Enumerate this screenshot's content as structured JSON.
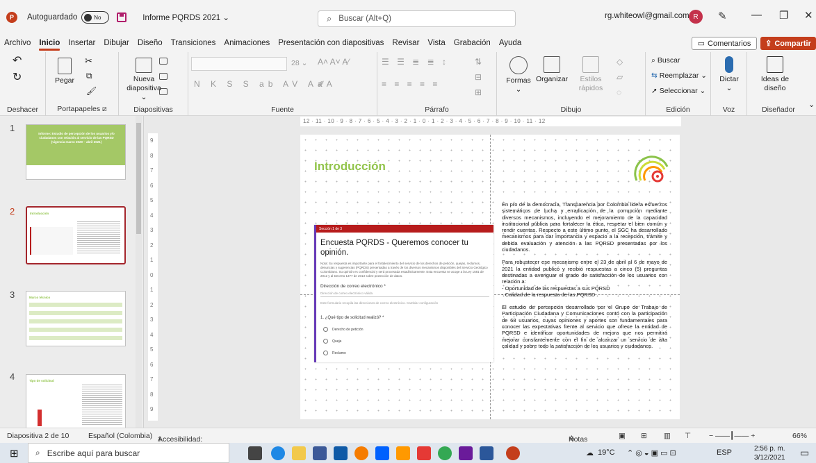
{
  "titlebar": {
    "autosave_label": "Autoguardado",
    "toggle_state": "No",
    "document_name": "Informe PQRDS 2021",
    "search_placeholder": "Buscar (Alt+Q)",
    "account_email": "rg.whiteowl@gmail.com",
    "avatar_initial": "R"
  },
  "menu": {
    "tabs": [
      "Archivo",
      "Inicio",
      "Insertar",
      "Dibujar",
      "Diseño",
      "Transiciones",
      "Animaciones",
      "Presentación con diapositivas",
      "Revisar",
      "Vista",
      "Grabación",
      "Ayuda"
    ],
    "active_tab": "Inicio",
    "comments_label": "Comentarios",
    "share_label": "Compartir"
  },
  "ribbon": {
    "undo_group_label": "Deshacer",
    "clipboard": {
      "paste_label": "Pegar",
      "group_label": "Portapapeles"
    },
    "slides": {
      "new_slide_label_1": "Nueva",
      "new_slide_label_2": "diapositiva",
      "group_label": "Diapositivas"
    },
    "font": {
      "size": "28",
      "group_label": "Fuente"
    },
    "paragraph": {
      "group_label": "Párrafo"
    },
    "drawing": {
      "shapes_label": "Formas",
      "arrange_label": "Organizar",
      "styles_label_1": "Estilos",
      "styles_label_2": "rápidos",
      "group_label": "Dibujo"
    },
    "editing": {
      "find_label": "Buscar",
      "replace_label": "Reemplazar",
      "select_label": "Seleccionar",
      "group_label": "Edición"
    },
    "voice": {
      "dictate_label": "Dictar",
      "group_label": "Voz"
    },
    "designer": {
      "ideas_label_1": "Ideas de",
      "ideas_label_2": "diseño",
      "group_label": "Diseñador"
    }
  },
  "thumbnails": [
    {
      "number": "1",
      "title": "Informe: Estudio de percepción de los usuarios y/o ciudadanos con relación al servicio de las PQRSD (vigencia marzo 2020 – abril 2021)"
    },
    {
      "number": "2",
      "title": "Introducción"
    },
    {
      "number": "3",
      "title": "Marco técnico"
    },
    {
      "number": "4",
      "title": "Tipo de solicitud"
    }
  ],
  "ruler": {
    "horizontal": "12 · 11 · 10 · 9 · 8 · 7 · 6 · 5 · 4 · 3 · 2 · 1 · 0 · 1 · 2 · 3 · 4 · 5 · 6 · 7 · 8 · 9 · 10 · 11 · 12",
    "vertical": [
      "9",
      "8",
      "7",
      "6",
      "5",
      "4",
      "3",
      "2",
      "1",
      "0",
      "1",
      "2",
      "3",
      "4",
      "5",
      "6",
      "7",
      "8",
      "9"
    ]
  },
  "slide": {
    "title": "Introducción",
    "form": {
      "section": "Sección 1 de 3",
      "title": "Encuesta PQRDS - Queremos conocer tu opinión.",
      "note": "Nota: Su respuesta es importante para el fortalecimiento del servicio de los derechos de petición, quejas, reclamos, denuncias y sugerencias (PQRDS) presentadas a través de los diversos mecanismos disponibles del Servicio Geológico Colombiano. Su opinión es confidencial y será procesada estadísticamente. Esta encuesta se acoge a la Ley 1581 de 2012 y al Decreto 1377 de 2013 sobre protección de datos.",
      "email_label": "Dirección de correo electrónico *",
      "email_placeholder": "Dirección de correo electrónico válida",
      "email_note": "Este formulario recopila las direcciones de correo electrónico. Cambiar configuración",
      "question": "1. ¿Qué tipo de solicitud realizó? *",
      "options": [
        "Derecho de petición",
        "Queja",
        "Reclamo"
      ]
    },
    "paragraphs": [
      "En pro de la democracia, Transparencia por Colombia lidera esfuerzos sistemáticos de lucha y erradicación de la corrupción mediante diversos mecanismos, incluyendo el mejoramiento de la capacidad institucional pública para fortalecer la ética, respetar el bien común y rendir cuentas. Respecto a este último punto, el SGC ha desarrollado mecanismos para dar importancia y espacio a la recepción, trámite y debida evaluación y atención a las PQRSD presentadas por los ciudadanos.",
      "Para robustecer ese mecanismo entre el 23 de abril al 6 de mayo de 2021 la entidad publicó y recibió respuestas a cinco (5) preguntas destinadas a averiguar el grado de satisfacción de los usuarios con relación a:",
      "El estudio de percepción desarrollado por el Grupo de Trabajo de Participación Ciudadana y Comunicaciones contó con la participación de 68 usuarios, cuyas opiniones y aportes son fundamentales para conocer las expectativas frente al servicio que ofrece la entidad de PQRSD e identificar oportunidades de mejora que nos permitirá mejorar constantemente con el fin de alcanzar un servicio de alta calidad y sobre todo la satisfacción de los usuarios y ciudadanos."
    ],
    "bullets": [
      "- Oportunidad de las respuestas a sus PQRSD",
      "- Calidad de la respuesta de las PQRSD"
    ]
  },
  "statusbar": {
    "slide_counter": "Diapositiva 2 de 10",
    "language": "Español (Colombia)",
    "accessibility": "Accesibilidad: es necesario investigar",
    "notes_label": "Notas",
    "zoom": "66%"
  },
  "taskbar": {
    "search_placeholder": "Escribe aquí para buscar",
    "temperature": "19°C",
    "language": "ESP",
    "time": "2:56 p. m.",
    "date": "3/12/2021"
  },
  "colors": {
    "accent": "#c43e1c",
    "slide_title": "#92c44c",
    "form_header": "#b71c1c",
    "selected_border": "#a4262c"
  }
}
